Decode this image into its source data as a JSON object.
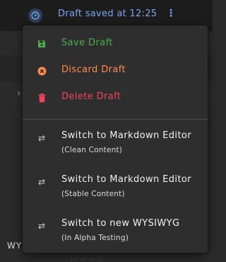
{
  "topbar": {
    "status_text": "Draft saved at 12:25",
    "kebab_glyph": "⋮",
    "clock_icon": "clock-icon"
  },
  "background": {
    "edge_text": "WY",
    "bottom_text": "...    ...     ... .."
  },
  "menu": {
    "items": [
      {
        "label": "Save Draft",
        "icon": "floppy-disk-icon",
        "color": "#4caf50"
      },
      {
        "label": "Discard Draft",
        "icon": "cancel-circle-icon",
        "color": "#ff8a50"
      },
      {
        "label": "Delete Draft",
        "icon": "trash-icon",
        "color": "#f0445a"
      }
    ],
    "switch_items": [
      {
        "label": "Switch to Markdown Editor",
        "sub": "(Clean Content)",
        "icon": "switch-arrows-icon"
      },
      {
        "label": "Switch to Markdown Editor",
        "sub": "(Stable Content)",
        "icon": "switch-arrows-icon"
      },
      {
        "label": "Switch to new WYSIWYG",
        "sub": "(In Alpha Testing)",
        "icon": "switch-arrows-icon"
      }
    ]
  },
  "colors": {
    "accent_blue": "#78a6f0",
    "save_green": "#4caf50",
    "discard_orange": "#ff8a50",
    "delete_red": "#f0445a",
    "menu_bg": "#2e2e2e"
  }
}
